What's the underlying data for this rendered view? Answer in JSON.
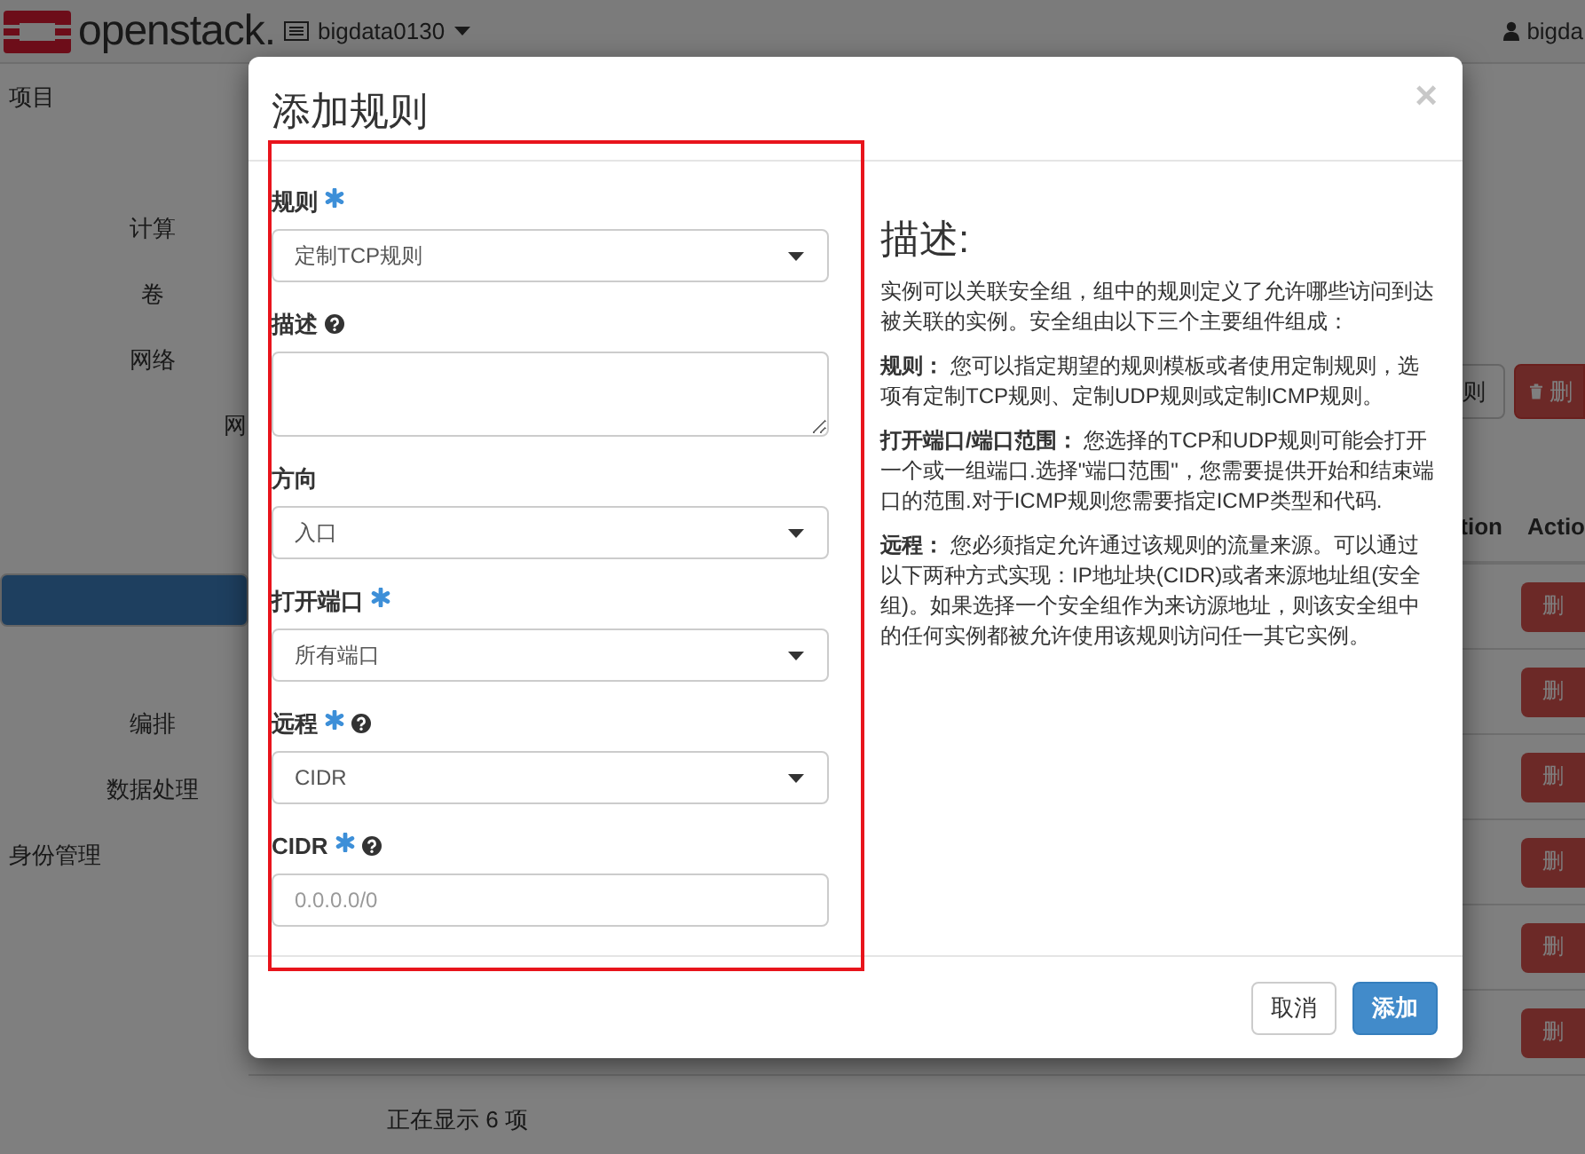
{
  "topbar": {
    "logo": "openstack.",
    "project": "bigdata0130",
    "user": "bigda"
  },
  "sidebar": {
    "items": [
      {
        "label": "项目",
        "children": [
          {
            "label": "计算"
          },
          {
            "label": "卷"
          },
          {
            "label": "网络",
            "children": [
              {
                "label": "网",
                "selected": false
              },
              {
                "selected": true
              }
            ]
          },
          {
            "label": "编排"
          },
          {
            "label": "数据处理"
          }
        ]
      },
      {
        "label": "身份管理"
      }
    ]
  },
  "main": {
    "toolbar": [
      {
        "label": "则",
        "kind": "outline"
      },
      {
        "label": "删",
        "kind": "danger"
      }
    ],
    "table": {
      "columns": [
        "tion",
        "Actio"
      ],
      "rows": [
        {
          "action": "删"
        },
        {
          "action": "删"
        },
        {
          "action": "删"
        },
        {
          "action": "删"
        },
        {
          "action": "删"
        },
        {
          "action": "删"
        }
      ]
    },
    "footer": "正在显示 6 项"
  },
  "dialog": {
    "title": "添加规则",
    "close": "×",
    "fields": [
      {
        "kind": "select",
        "label": "规则",
        "required": true,
        "help": false,
        "value": "定制TCP规则"
      },
      {
        "kind": "textarea",
        "label": "描述",
        "required": false,
        "help": true
      },
      {
        "kind": "select",
        "label": "方向",
        "required": false,
        "help": false,
        "value": "入口"
      },
      {
        "kind": "select",
        "label": "打开端口",
        "required": true,
        "help": false,
        "value": "所有端口"
      },
      {
        "kind": "select",
        "label": "远程",
        "required": true,
        "help": true,
        "value": "CIDR"
      },
      {
        "kind": "input",
        "label": "CIDR",
        "required": true,
        "help": true,
        "placeholder": "0.0.0.0/0"
      }
    ],
    "description": {
      "heading": "描述:",
      "paragraphs": [
        "实例可以关联安全组，组中的规则定义了允许哪些访问到达被关联的实例。安全组由以下三个主要组件组成：",
        "**规则：** 您可以指定期望的规则模板或者使用定制规则，选项有定制TCP规则、定制UDP规则或定制ICMP规则。",
        "**打开端口/端口范围：** 您选择的TCP和UDP规则可能会打开一个或一组端口.选择\"端口范围\"，您需要提供开始和结束端口的范围.对于ICMP规则您需要指定ICMP类型和代码.",
        "**远程：** 您必须指定允许通过该规则的流量来源。可以通过以下两种方式实现：IP地址块(CIDR)或者来源地址组(安全组)。如果选择一个安全组作为来访源地址，则该安全组中的任何实例都被允许使用该规则访问任一其它实例。"
      ]
    },
    "buttons": [
      {
        "label": "取消",
        "kind": "default"
      },
      {
        "label": "添加",
        "kind": "primary"
      }
    ],
    "annotation": {
      "kind": "rectangle"
    }
  }
}
